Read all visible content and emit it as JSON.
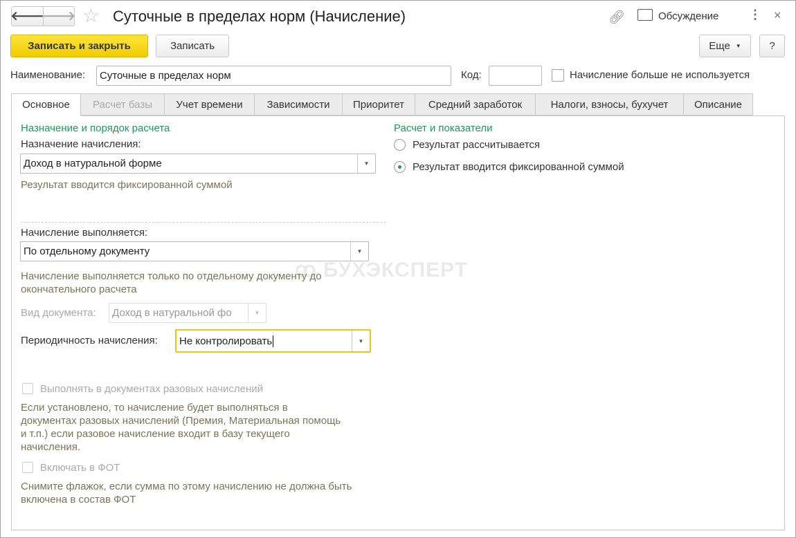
{
  "title": "Суточные в пределах норм (Начисление)",
  "header": {
    "discussion": "Обсуждение"
  },
  "toolbar": {
    "save_close": "Записать и закрыть",
    "save": "Записать",
    "more": "Еще",
    "help": "?"
  },
  "fields": {
    "name_label": "Наименование:",
    "name_value": "Суточные в пределах норм",
    "code_label": "Код:",
    "code_value": "",
    "unused_label": "Начисление больше не используется"
  },
  "tabs": [
    "Основное",
    "Расчет базы",
    "Учет времени",
    "Зависимости",
    "Приоритет",
    "Средний заработок",
    "Налоги, взносы, бухучет",
    "Описание"
  ],
  "left": {
    "section_title": "Назначение и порядок расчета",
    "purpose_label": "Назначение начисления:",
    "purpose_value": "Доход в натуральной форме",
    "purpose_hint": "Результат вводится фиксированной суммой",
    "executed_label": "Начисление выполняется:",
    "executed_value": "По отдельному документу",
    "executed_hint": "Начисление выполняется только по отдельному документу до окончательного расчета",
    "doc_kind_label": "Вид документа:",
    "doc_kind_value": "Доход в натуральной фо",
    "period_label": "Периодичность начисления:",
    "period_value": "Не контролировать",
    "onetime_label": "Выполнять в документах разовых начислений",
    "onetime_hint": "Если установлено, то начисление будет выполняться в документах разовых начислений (Премия, Материальная помощь и т.п.) если разовое начисление входит в базу текущего начисления.",
    "fot_label": "Включать в ФОТ",
    "fot_hint": "Снимите флажок, если сумма по этому начислению не должна быть включена в состав ФОТ"
  },
  "right": {
    "section_title": "Расчет и показатели",
    "radio1": "Результат рассчитывается",
    "radio2": "Результат вводится фиксированной суммой",
    "selected": 2
  },
  "watermark": "БУХЭКСПЕРТ",
  "colors": {
    "accent": "#f5d400",
    "section": "#1a9a5a",
    "hint": "#7d7358"
  }
}
